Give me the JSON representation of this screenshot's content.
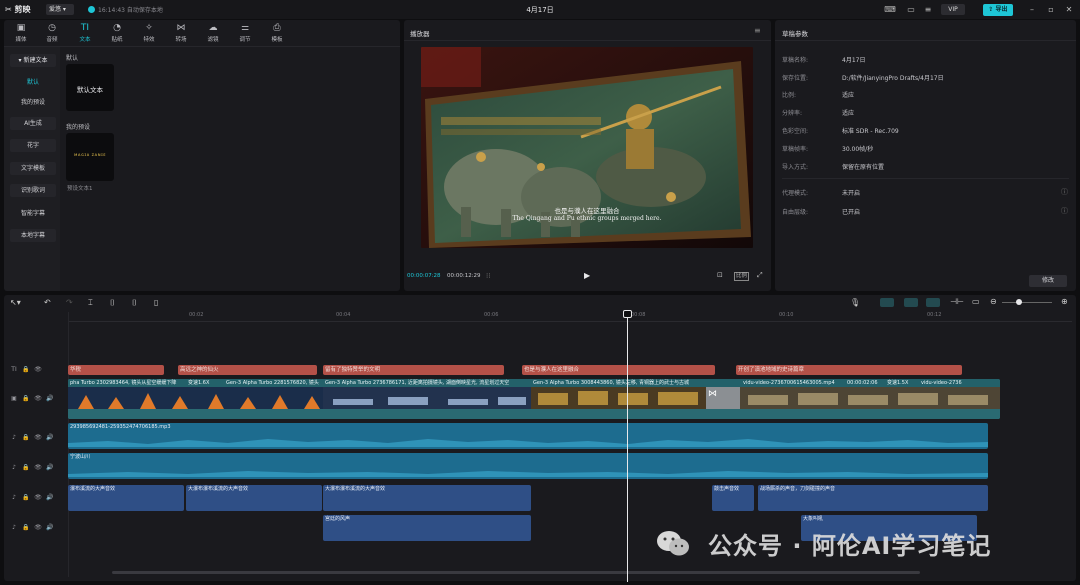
{
  "titlebar": {
    "app_name": "剪映",
    "user": "爱悠",
    "save_status": "16:14:43 自动保存本地",
    "title": "4月17日",
    "vip_label": "VIP",
    "export_label": "导出"
  },
  "media_toolbar": [
    {
      "label": "媒体",
      "icon": "media-icon"
    },
    {
      "label": "音频",
      "icon": "audio-icon"
    },
    {
      "label": "文本",
      "icon": "text-icon",
      "active": true
    },
    {
      "label": "贴纸",
      "icon": "sticker-icon"
    },
    {
      "label": "特效",
      "icon": "effects-icon"
    },
    {
      "label": "转场",
      "icon": "transition-icon"
    },
    {
      "label": "滤镜",
      "icon": "filter-icon"
    },
    {
      "label": "调节",
      "icon": "adjust-icon"
    },
    {
      "label": "模板",
      "icon": "template-icon"
    }
  ],
  "sidebar": {
    "items": [
      {
        "label": "▾ 新建文本",
        "selected": false,
        "box": true
      },
      {
        "label": "默认",
        "selected": true,
        "box": false
      },
      {
        "label": "我的预设",
        "selected": false,
        "box": false
      },
      {
        "label": "AI生成",
        "selected": false,
        "box": true
      },
      {
        "label": "花字",
        "selected": false,
        "box": true
      },
      {
        "label": "文字模板",
        "selected": false,
        "box": true
      },
      {
        "label": "识别歌词",
        "selected": false,
        "box": true
      },
      {
        "label": "智能字幕",
        "selected": false,
        "box": false
      },
      {
        "label": "本地字幕",
        "selected": false,
        "box": true
      }
    ]
  },
  "media_content": {
    "section_default": "默认",
    "default_thumb_label": "默认文本",
    "section_preset": "我的预设",
    "preset_caption": "预设文本1",
    "preset_thumb_text": "ᴍᴀɢɪᴀ ᴢᴀɴɪᴇ"
  },
  "player": {
    "title": "播放器",
    "subtitle_cn": "也是与濮人在这里融合",
    "subtitle_en": "The Qingang and Pu ethnic groups merged here.",
    "current_time": "00:00:07:28",
    "total_time": "00:00:12:29",
    "ratio_label": "比例"
  },
  "params": {
    "title": "草稿参数",
    "rows": [
      {
        "label": "草稿名称:",
        "value": "4月17日"
      },
      {
        "label": "保存位置:",
        "value": "D:/软件/JianyingPro Drafts/4月17日"
      },
      {
        "label": "比例:",
        "value": "适应"
      },
      {
        "label": "分辨率:",
        "value": "适应"
      },
      {
        "label": "色彩空间:",
        "value": "标准 SDR - Rec.709"
      },
      {
        "label": "草稿帧率:",
        "value": "30.00帧/秒"
      },
      {
        "label": "导入方式:",
        "value": "保留在原有位置"
      },
      {
        "label": "代理模式:",
        "value": "未开启"
      },
      {
        "label": "自由层级:",
        "value": "已开启"
      }
    ],
    "modify_label": "修改"
  },
  "ruler": [
    "00:02",
    "00:04",
    "00:06",
    "00:08",
    "00:10",
    "00:12"
  ],
  "text_track": [
    "华税",
    "高远之神的仙火",
    "留有了独特赞举的文明",
    "也是与濮人在这里融合",
    "开创了滇池地域的史诗篇章"
  ],
  "video_track": [
    "pha Turbo 2302983464, 镜头从星空缓缓下降",
    "变速1.6X",
    "Gen-3 Alpha Turbo 2281576820, 镜头",
    "Gen-3 Alpha Turbo 2736786171, 近距离拍摄镜头, 湖面倒映星光, 流星划过天空",
    "Gen-3 Alpha Turbo 3008443860, 镜头左移, 青铜器上的武士与古城",
    "vidu-video-2736700615463005.mp4",
    "00:00:02:06",
    "变速1.5X",
    "vidu-video-2736"
  ],
  "audio_tracks": {
    "bgm": "293985692481-259352474706185.mp3",
    "voice": "宁波山川",
    "sfx1": [
      "瀑布溪流的大声音效",
      "大瀑布瀑布溪流的大声音效",
      "大瀑布瀑布溪流的大声音效",
      "敲击声音效",
      "战场厮杀的声音，刀剑碰撞的声音"
    ],
    "sfx2": [
      "宫廷的风声",
      "大象叫吼"
    ]
  },
  "watermark": "公众号 · 阿伦AI学习笔记",
  "colors": {
    "accent": "#1ec6d6",
    "text_clip": "#b45148",
    "audio_clip": "#2f4f86",
    "bgm_clip": "#1d6c8f"
  }
}
